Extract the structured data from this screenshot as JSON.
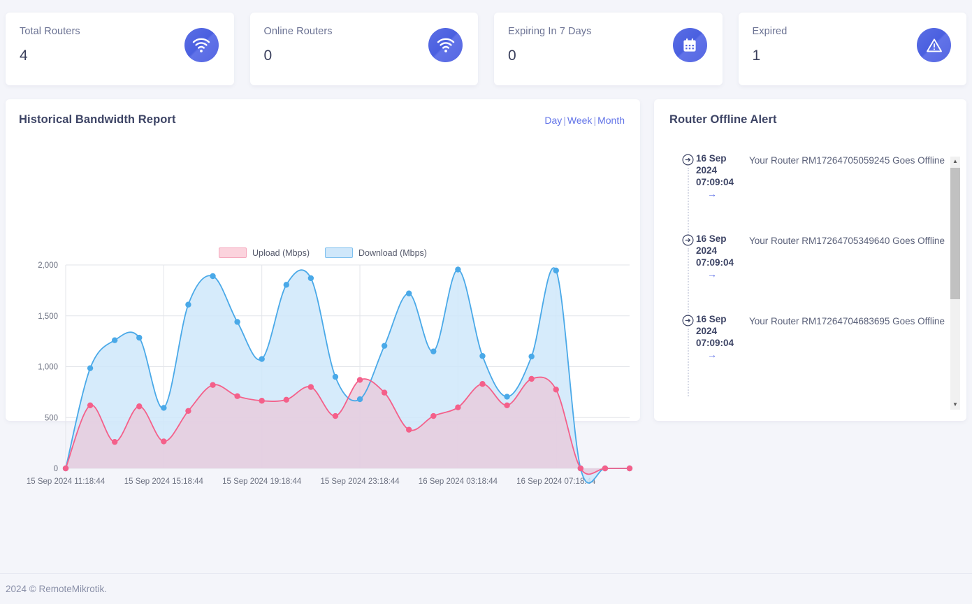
{
  "stats": [
    {
      "label": "Total Routers",
      "value": "4",
      "icon": "wifi-icon"
    },
    {
      "label": "Online Routers",
      "value": "0",
      "icon": "wifi-icon"
    },
    {
      "label": "Expiring In 7 Days",
      "value": "0",
      "icon": "calendar-icon"
    },
    {
      "label": "Expired",
      "value": "1",
      "icon": "warning-triangle-icon"
    }
  ],
  "chart_panel": {
    "title": "Historical Bandwidth Report",
    "ranges": [
      {
        "label": "Day"
      },
      {
        "label": "Week"
      },
      {
        "label": "Month"
      }
    ],
    "separator": "|"
  },
  "alerts_panel": {
    "title": "Router Offline Alert",
    "items": [
      {
        "date": "16 Sep 2024 07:09:04",
        "message": "Your Router RM17264705059245 Goes Offline",
        "arrow": "→"
      },
      {
        "date": "16 Sep 2024 07:09:04",
        "message": "Your Router RM17264705349640 Goes Offline",
        "arrow": "→"
      },
      {
        "date": "16 Sep 2024 07:09:04",
        "message": "Your Router RM17264704683695 Goes Offline",
        "arrow": "→"
      }
    ]
  },
  "footer": {
    "text": "2024 © RemoteMikrotik."
  },
  "colors": {
    "accent": "#6173e8",
    "upload_line": "#f4608a",
    "upload_fill": "#e7cfe0",
    "download_line": "#4aa9e8",
    "download_fill": "#cfe7fa",
    "card_bg": "#ffffff",
    "page_bg": "#f4f5fa"
  },
  "chart_data": {
    "type": "area",
    "title": "Historical Bandwidth Report",
    "xlabel": "",
    "ylabel": "",
    "ylim": [
      0,
      2000
    ],
    "yticks": [
      0,
      500,
      1000,
      1500,
      2000
    ],
    "ytick_labels": [
      "0",
      "500",
      "1,000",
      "1,500",
      "2,000"
    ],
    "grid": true,
    "legend_position": "top-center",
    "xtick_labels": [
      "15 Sep 2024 11:18:44",
      "15 Sep 2024 15:18:44",
      "15 Sep 2024 19:18:44",
      "15 Sep 2024 23:18:44",
      "16 Sep 2024 03:18:44",
      "16 Sep 2024 07:18:44"
    ],
    "xtick_indices": [
      0,
      4,
      8,
      12,
      16,
      20
    ],
    "series": [
      {
        "name": "Upload (Mbps)",
        "color": "#f4608a",
        "fill": "#e7cfe0",
        "values": [
          0,
          620,
          260,
          610,
          265,
          565,
          820,
          710,
          665,
          675,
          800,
          515,
          870,
          745,
          380,
          515,
          600,
          830,
          620,
          880,
          775,
          0,
          0,
          0
        ]
      },
      {
        "name": "Download (Mbps)",
        "color": "#4aa9e8",
        "fill": "#cfe7fa",
        "values": [
          0,
          985,
          1260,
          1285,
          595,
          1610,
          1890,
          1440,
          1075,
          1805,
          1870,
          900,
          680,
          1205,
          1720,
          1150,
          1955,
          1105,
          705,
          1100,
          1945,
          0,
          0,
          0
        ]
      }
    ]
  }
}
